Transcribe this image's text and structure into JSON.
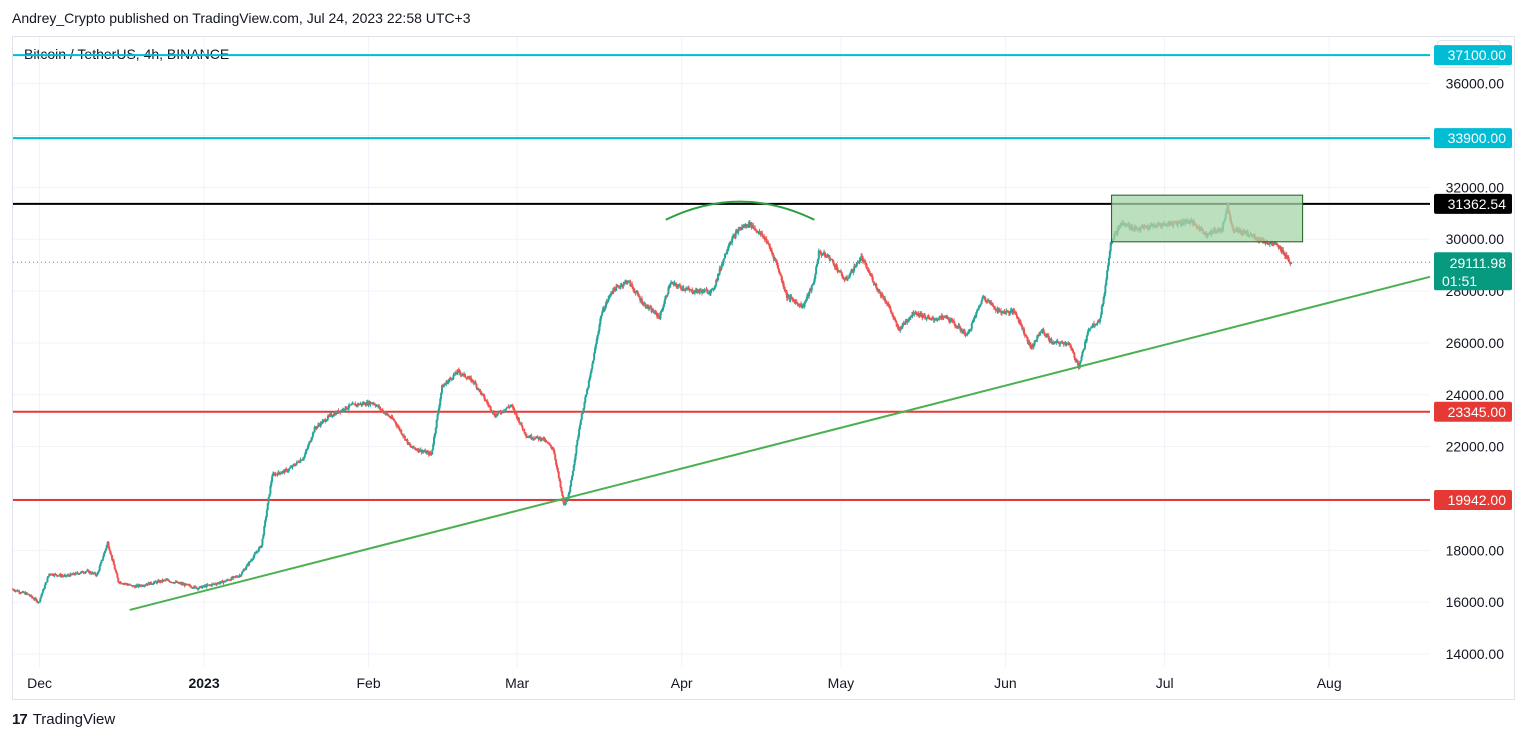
{
  "header": {
    "published": "Andrey_Crypto published on TradingView.com, Jul 24, 2023 22:58 UTC+3",
    "symbol": "Bitcoin / TetherUS, 4h, BINANCE",
    "currency": "USDT"
  },
  "footer": {
    "brand": "TradingView",
    "logo": "17"
  },
  "colors": {
    "up": "#26a69a",
    "down": "#ef5350",
    "cyan_level": "#00bcd4",
    "red_level": "#e53935",
    "black_level": "#000000",
    "trendline": "#4caf50",
    "box_fill": "#a5d6a7",
    "box_border": "#1b5e20"
  },
  "chart_data": {
    "type": "candlestick",
    "x_ticks": [
      {
        "label": "Dec",
        "date": "2022-12-01",
        "bold": false
      },
      {
        "label": "2023",
        "date": "2023-01-01",
        "bold": true
      },
      {
        "label": "Feb",
        "date": "2023-02-01",
        "bold": false
      },
      {
        "label": "Mar",
        "date": "2023-03-01",
        "bold": false
      },
      {
        "label": "Apr",
        "date": "2023-04-01",
        "bold": false
      },
      {
        "label": "May",
        "date": "2023-05-01",
        "bold": false
      },
      {
        "label": "Jun",
        "date": "2023-06-01",
        "bold": false
      },
      {
        "label": "Jul",
        "date": "2023-07-01",
        "bold": false
      },
      {
        "label": "Aug",
        "date": "2023-08-01",
        "bold": false
      }
    ],
    "y_ticks": [
      {
        "value": 14000,
        "label": "14000.00"
      },
      {
        "value": 16000,
        "label": "16000.00"
      },
      {
        "value": 18000,
        "label": "18000.00"
      },
      {
        "value": 20000,
        "label": "20000.00"
      },
      {
        "value": 22000,
        "label": "22000.00"
      },
      {
        "value": 24000,
        "label": "24000.00"
      },
      {
        "value": 26000,
        "label": "26000.00"
      },
      {
        "value": 28000,
        "label": "28000.00"
      },
      {
        "value": 30000,
        "label": "30000.00"
      },
      {
        "value": 32000,
        "label": "32000.00"
      },
      {
        "value": 34000,
        "label": "34000.00"
      },
      {
        "value": 36000,
        "label": "36000.00"
      }
    ],
    "y_range": [
      13500,
      37800
    ],
    "x_range": [
      "2022-11-26",
      "2023-08-20"
    ],
    "last_price": {
      "value": 29111.98,
      "label": "29111.98",
      "countdown": "01:51"
    },
    "horizontal_levels": [
      {
        "value": 37100,
        "label": "37100.00",
        "color": "cyan"
      },
      {
        "value": 33900,
        "label": "33900.00",
        "color": "cyan"
      },
      {
        "value": 31362.54,
        "label": "31362.54",
        "color": "black"
      },
      {
        "value": 23345,
        "label": "23345.00",
        "color": "red"
      },
      {
        "value": 19942,
        "label": "19942.00",
        "color": "red"
      }
    ],
    "trendline": {
      "start": {
        "date": "2022-12-18",
        "value": 15700
      },
      "end": {
        "date": "2023-08-20",
        "value": 28550
      }
    },
    "range_box": {
      "start": "2023-06-21",
      "end": "2023-07-27",
      "top": 31700,
      "bottom": 29900
    },
    "arc": {
      "start": "2023-03-29",
      "end": "2023-04-26",
      "base": 30750,
      "peak": 31450
    },
    "price_path": [
      [
        "2022-11-26",
        16500
      ],
      [
        "2022-11-29",
        16300
      ],
      [
        "2022-12-01",
        16000
      ],
      [
        "2022-12-03",
        17100
      ],
      [
        "2022-12-06",
        17000
      ],
      [
        "2022-12-10",
        17200
      ],
      [
        "2022-12-12",
        17050
      ],
      [
        "2022-12-14",
        18300
      ],
      [
        "2022-12-16",
        16800
      ],
      [
        "2022-12-19",
        16600
      ],
      [
        "2022-12-25",
        16850
      ],
      [
        "2022-12-31",
        16550
      ],
      [
        "2023-01-05",
        16800
      ],
      [
        "2023-01-08",
        17050
      ],
      [
        "2023-01-12",
        18200
      ],
      [
        "2023-01-14",
        20900
      ],
      [
        "2023-01-17",
        21100
      ],
      [
        "2023-01-20",
        21600
      ],
      [
        "2023-01-22",
        22700
      ],
      [
        "2023-01-25",
        23200
      ],
      [
        "2023-01-29",
        23600
      ],
      [
        "2023-02-02",
        23700
      ],
      [
        "2023-02-06",
        23000
      ],
      [
        "2023-02-09",
        22000
      ],
      [
        "2023-02-13",
        21700
      ],
      [
        "2023-02-15",
        24300
      ],
      [
        "2023-02-18",
        24900
      ],
      [
        "2023-02-21",
        24500
      ],
      [
        "2023-02-25",
        23200
      ],
      [
        "2023-02-28",
        23600
      ],
      [
        "2023-03-03",
        22400
      ],
      [
        "2023-03-06",
        22300
      ],
      [
        "2023-03-08",
        21900
      ],
      [
        "2023-03-10",
        19700
      ],
      [
        "2023-03-11",
        20200
      ],
      [
        "2023-03-13",
        22900
      ],
      [
        "2023-03-15",
        24800
      ],
      [
        "2023-03-17",
        27100
      ],
      [
        "2023-03-19",
        28000
      ],
      [
        "2023-03-22",
        28400
      ],
      [
        "2023-03-25",
        27500
      ],
      [
        "2023-03-28",
        27000
      ],
      [
        "2023-03-30",
        28300
      ],
      [
        "2023-04-03",
        28000
      ],
      [
        "2023-04-07",
        28000
      ],
      [
        "2023-04-10",
        29800
      ],
      [
        "2023-04-12",
        30400
      ],
      [
        "2023-04-14",
        30600
      ],
      [
        "2023-04-17",
        30000
      ],
      [
        "2023-04-19",
        29100
      ],
      [
        "2023-04-21",
        27800
      ],
      [
        "2023-04-24",
        27400
      ],
      [
        "2023-04-26",
        28300
      ],
      [
        "2023-04-27",
        29500
      ],
      [
        "2023-04-29",
        29300
      ],
      [
        "2023-05-02",
        28400
      ],
      [
        "2023-05-05",
        29300
      ],
      [
        "2023-05-08",
        28100
      ],
      [
        "2023-05-10",
        27500
      ],
      [
        "2023-05-12",
        26500
      ],
      [
        "2023-05-15",
        27200
      ],
      [
        "2023-05-18",
        26900
      ],
      [
        "2023-05-21",
        27000
      ],
      [
        "2023-05-25",
        26300
      ],
      [
        "2023-05-28",
        27800
      ],
      [
        "2023-05-31",
        27200
      ],
      [
        "2023-06-03",
        27200
      ],
      [
        "2023-06-06",
        25800
      ],
      [
        "2023-06-08",
        26500
      ],
      [
        "2023-06-10",
        26000
      ],
      [
        "2023-06-13",
        26000
      ],
      [
        "2023-06-15",
        25100
      ],
      [
        "2023-06-17",
        26600
      ],
      [
        "2023-06-19",
        26900
      ],
      [
        "2023-06-20",
        28200
      ],
      [
        "2023-06-21",
        29900
      ],
      [
        "2023-06-23",
        30600
      ],
      [
        "2023-06-26",
        30400
      ],
      [
        "2023-06-29",
        30500
      ],
      [
        "2023-07-02",
        30600
      ],
      [
        "2023-07-06",
        30700
      ],
      [
        "2023-07-09",
        30200
      ],
      [
        "2023-07-12",
        30400
      ],
      [
        "2023-07-13",
        31300
      ],
      [
        "2023-07-14",
        30400
      ],
      [
        "2023-07-17",
        30200
      ],
      [
        "2023-07-20",
        29900
      ],
      [
        "2023-07-22",
        29800
      ],
      [
        "2023-07-24",
        29400
      ],
      [
        "2023-07-24T20:00",
        29111.98
      ]
    ]
  }
}
